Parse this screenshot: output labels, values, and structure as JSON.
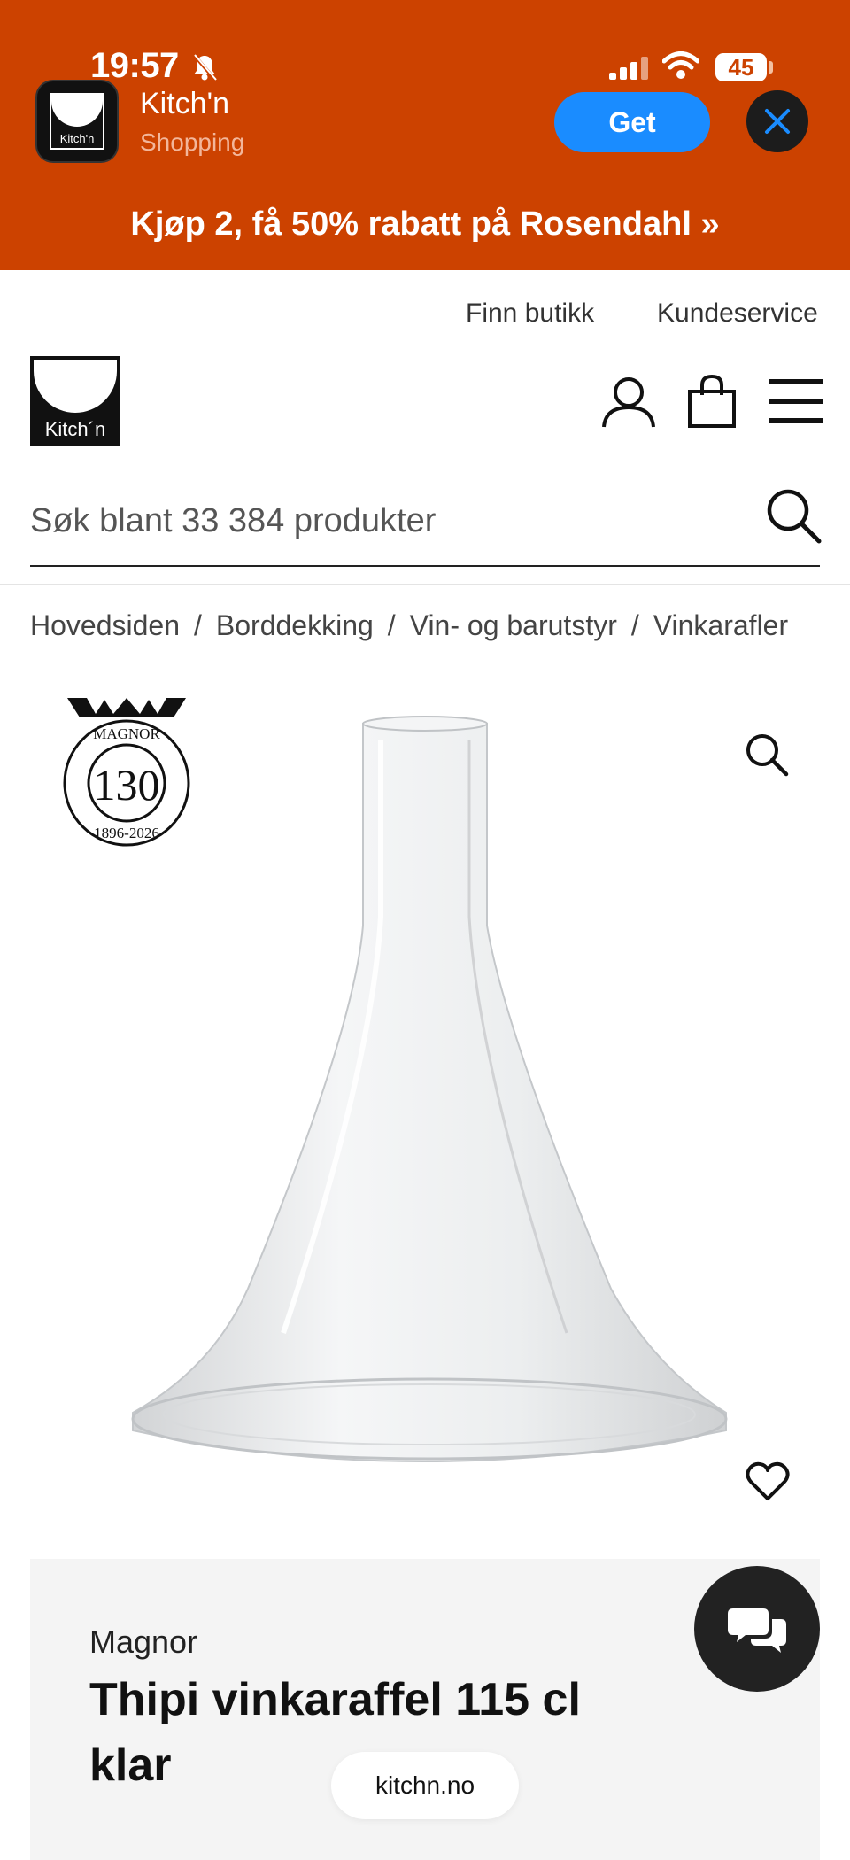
{
  "status_bar": {
    "time": "19:57",
    "battery": "45"
  },
  "app_banner": {
    "app_name": "Kitch'n",
    "category": "Shopping",
    "icon_text": "Kitch'n",
    "get_label": "Get",
    "promo_text": "Kjøp 2, få 50% rabatt på Rosendahl »",
    "background_color": "#cc4200",
    "get_button_color": "#1a8cff"
  },
  "top_links": {
    "find_store": "Finn butikk",
    "customer_service": "Kundeservice"
  },
  "header": {
    "logo_text": "Kitch´n",
    "icons": [
      "user-icon",
      "shopping-bag-icon",
      "menu-icon"
    ]
  },
  "search": {
    "placeholder": "Søk blant 33 384 produkter",
    "value": ""
  },
  "breadcrumb": {
    "items": [
      "Hovedsiden",
      "Borddekking",
      "Vin- og barutstyr",
      "Vinkarafler"
    ],
    "separator": "/"
  },
  "product": {
    "badge": {
      "brand": "MAGNOR",
      "number": "130",
      "years": "1896-2026"
    },
    "brand": "Magnor",
    "title": "Thipi vinkaraffel 115 cl klar"
  },
  "browser": {
    "url": "kitchn.no"
  }
}
